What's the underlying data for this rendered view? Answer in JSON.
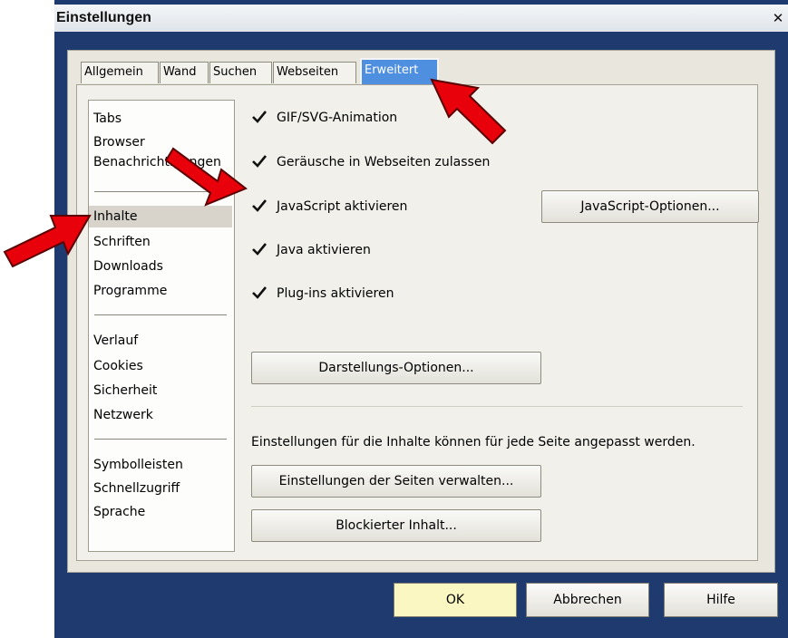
{
  "window": {
    "title": "Einstellungen",
    "close_glyph": "✕"
  },
  "tabs": [
    {
      "label": "Allgemein",
      "active": false
    },
    {
      "label": "Wand",
      "active": false
    },
    {
      "label": "Suchen",
      "active": false
    },
    {
      "label": "Webseiten",
      "active": false
    },
    {
      "label": "Erweitert",
      "active": true
    }
  ],
  "sidebar": {
    "groups": [
      [
        "Tabs",
        "Browser",
        "Benachrichtigungen"
      ],
      [
        "Inhalte",
        "Schriften",
        "Downloads",
        "Programme"
      ],
      [
        "Verlauf",
        "Cookies",
        "Sicherheit",
        "Netzwerk"
      ],
      [
        "Symbolleisten",
        "Schnellzugriff",
        "Sprache"
      ]
    ],
    "selected": "Inhalte"
  },
  "options": [
    {
      "label": "GIF/SVG-Animation",
      "checked": true
    },
    {
      "label": "Geräusche in Webseiten zulassen",
      "checked": true
    },
    {
      "label": "JavaScript aktivieren",
      "checked": true
    },
    {
      "label": "Java aktivieren",
      "checked": true
    },
    {
      "label": "Plug-ins aktivieren",
      "checked": true
    }
  ],
  "buttons": {
    "javascript_options": "JavaScript-Optionen...",
    "display_options": "Darstellungs-Optionen...",
    "manage_sites": "Einstellungen der Seiten verwalten...",
    "blocked_content": "Blockierter Inhalt..."
  },
  "info_text": "Einstellungen für die Inhalte können für jede Seite angepasst werden.",
  "footer": {
    "ok": "OK",
    "cancel": "Abbrechen",
    "help": "Hilfe"
  },
  "annotation_color": "#e8000b",
  "checkmark_icon": "check-icon"
}
